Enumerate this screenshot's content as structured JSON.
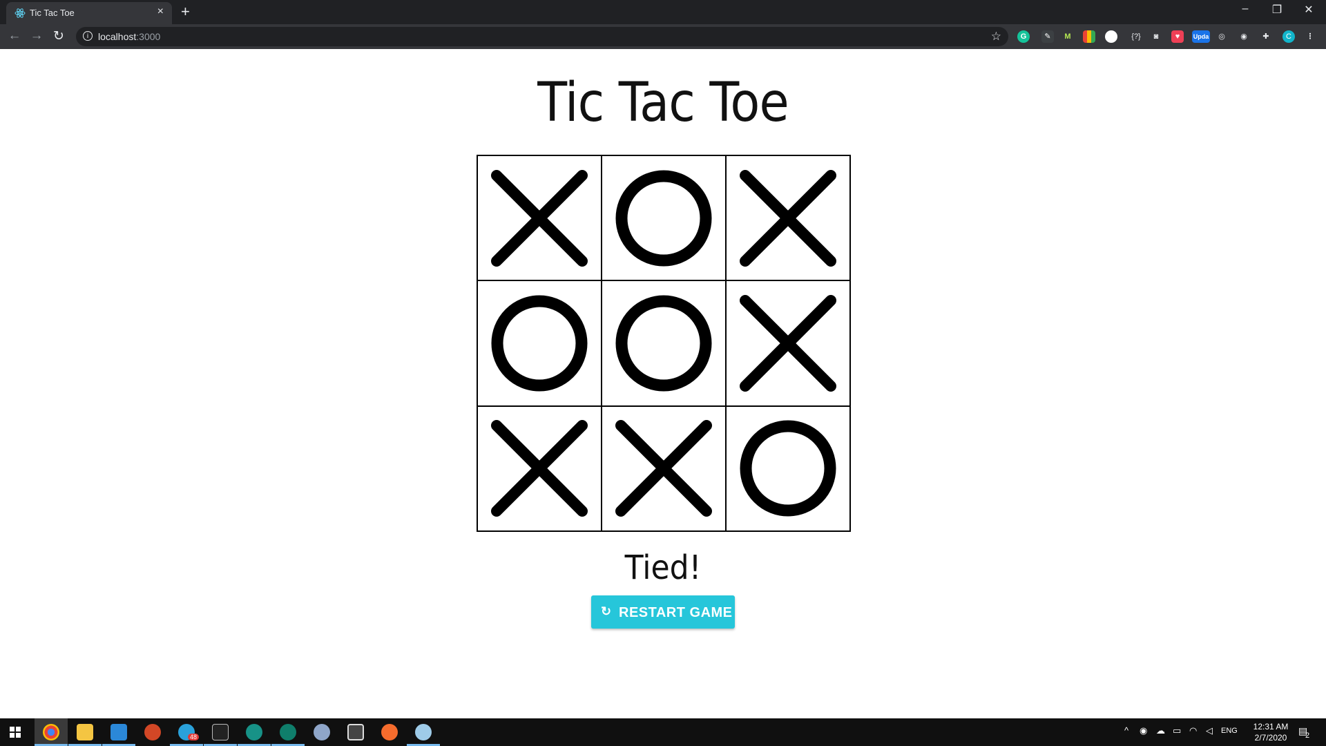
{
  "browser": {
    "tab_title": "Tic Tac Toe",
    "url_host": "localhost",
    "url_port": ":3000",
    "new_tab": "+",
    "close_tab": "×",
    "window_minimize": "–",
    "window_restore": "❐",
    "window_close": "✕",
    "extensions": [
      "grammarly-icon",
      "pin-icon",
      "m-icon",
      "color-grid-icon",
      "circle-icon",
      "braces-icon",
      "camera-icon",
      "pocket-icon",
      "update-icon",
      "spy-icon",
      "target-icon",
      "puzzle-icon",
      "profile-avatar"
    ],
    "ext_labels": {
      "m": "M",
      "braces": "{?}",
      "profile": "C",
      "update": "Upda"
    }
  },
  "game": {
    "title": "Tic Tac Toe",
    "board": [
      "X",
      "O",
      "X",
      "O",
      "O",
      "X",
      "X",
      "X",
      "O"
    ],
    "status": "Tied!",
    "restart_label": "RESTART GAME"
  },
  "taskbar": {
    "apps": [
      "chrome-icon",
      "file-explorer-icon",
      "mail-icon",
      "powerpoint-icon",
      "telegram-icon",
      "terminal-icon",
      "gitkraken-icon",
      "android-studio-icon",
      "paint-icon",
      "calculator-icon",
      "origin-icon",
      "paint3d-icon"
    ],
    "telegram_badge": "48",
    "language": "ENG",
    "time": "12:31 AM",
    "date": "2/7/2020",
    "notifications": "2"
  },
  "colors": {
    "accent_button": "#26c6da",
    "mark": "#000000",
    "chrome_dark": "#202124",
    "chrome_toolbar": "#35363a"
  }
}
